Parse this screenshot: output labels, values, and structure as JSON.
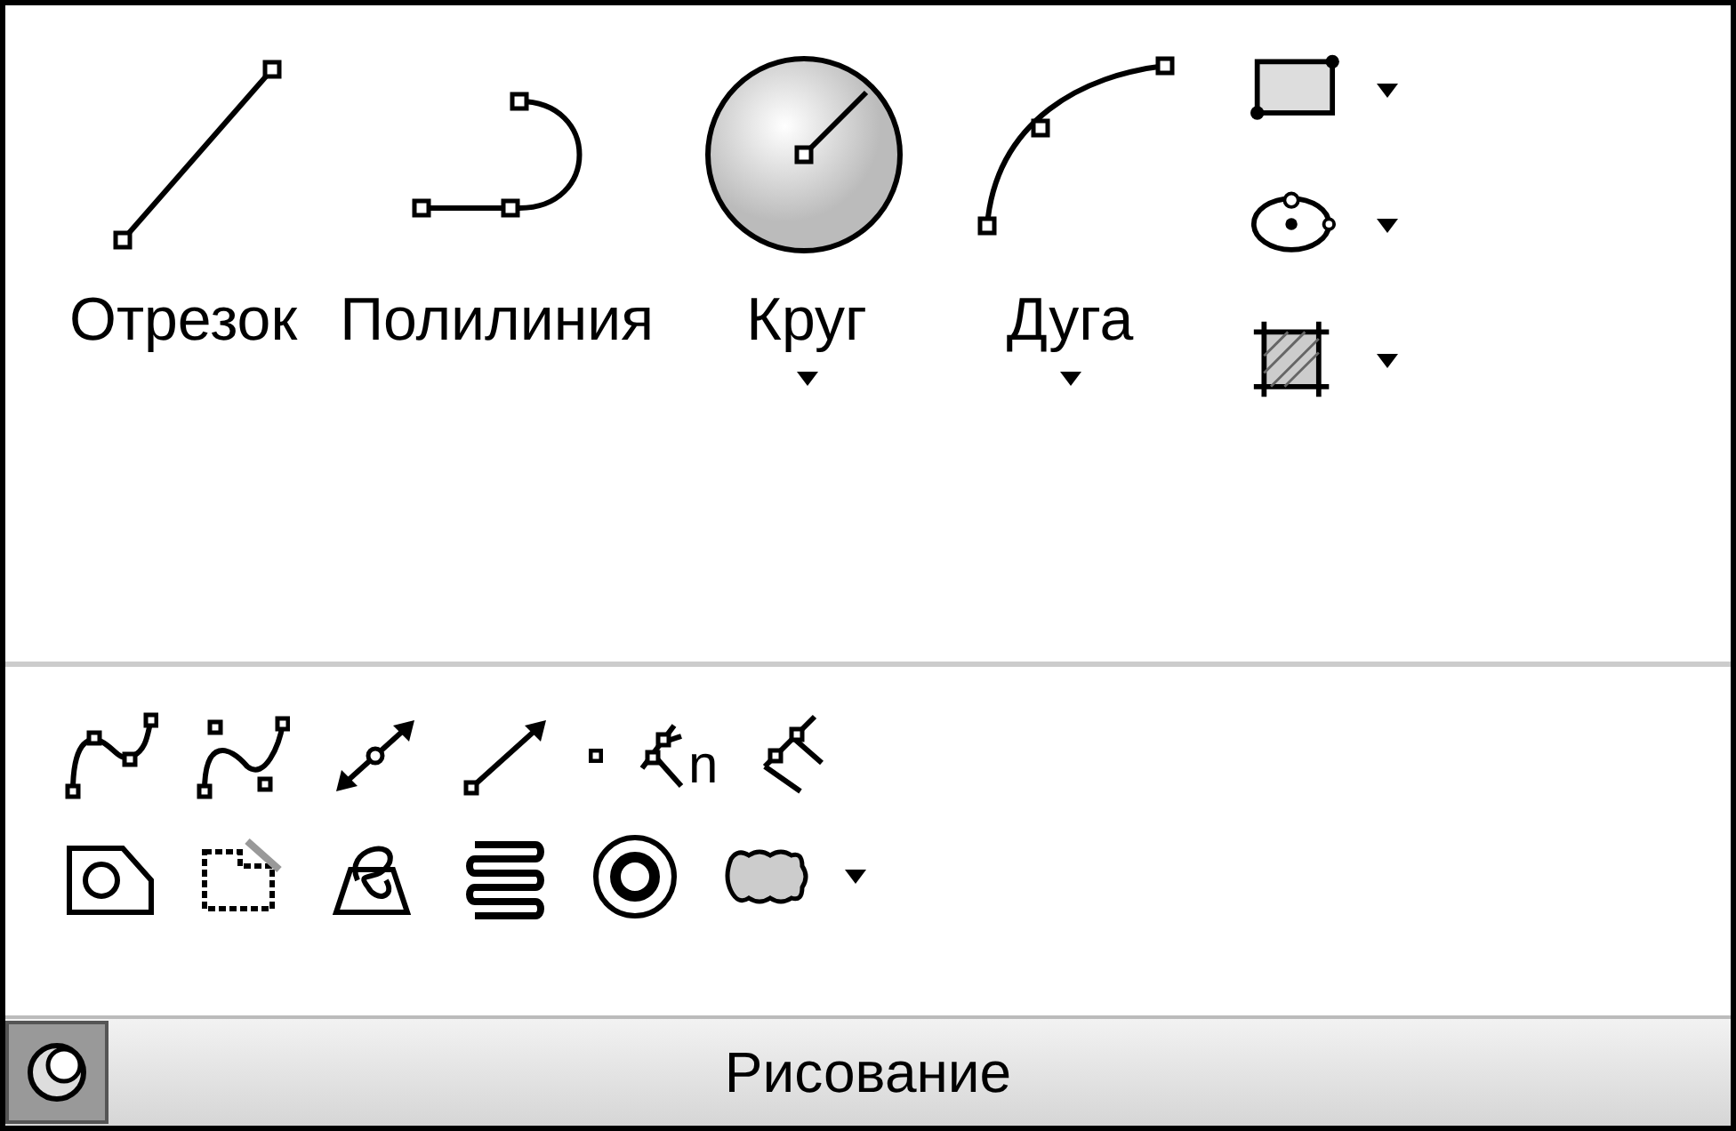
{
  "panel": {
    "title": "Рисование"
  },
  "large_tools": [
    {
      "kind": "line",
      "label": "Отрезок",
      "dropdown": false
    },
    {
      "kind": "polyline",
      "label": "Полилиния",
      "dropdown": false
    },
    {
      "kind": "circle",
      "label": "Круг",
      "dropdown": true
    },
    {
      "kind": "arc",
      "label": "Дуга",
      "dropdown": true
    }
  ],
  "side_tools": [
    {
      "kind": "rectangle",
      "dropdown": true
    },
    {
      "kind": "ellipse",
      "dropdown": true
    },
    {
      "kind": "hatch",
      "dropdown": true
    }
  ],
  "row_1": [
    {
      "kind": "spline-fit"
    },
    {
      "kind": "spline-cv"
    },
    {
      "kind": "xline"
    },
    {
      "kind": "ray"
    },
    {
      "kind": "point"
    },
    {
      "kind": "divide",
      "label": "n"
    },
    {
      "kind": "measure"
    }
  ],
  "row_2": [
    {
      "kind": "region",
      "dropdown": false
    },
    {
      "kind": "wipeout",
      "dropdown": false
    },
    {
      "kind": "boundary",
      "dropdown": false
    },
    {
      "kind": "helix",
      "dropdown": false
    },
    {
      "kind": "donut",
      "dropdown": false
    },
    {
      "kind": "revcloud",
      "dropdown": true
    }
  ]
}
